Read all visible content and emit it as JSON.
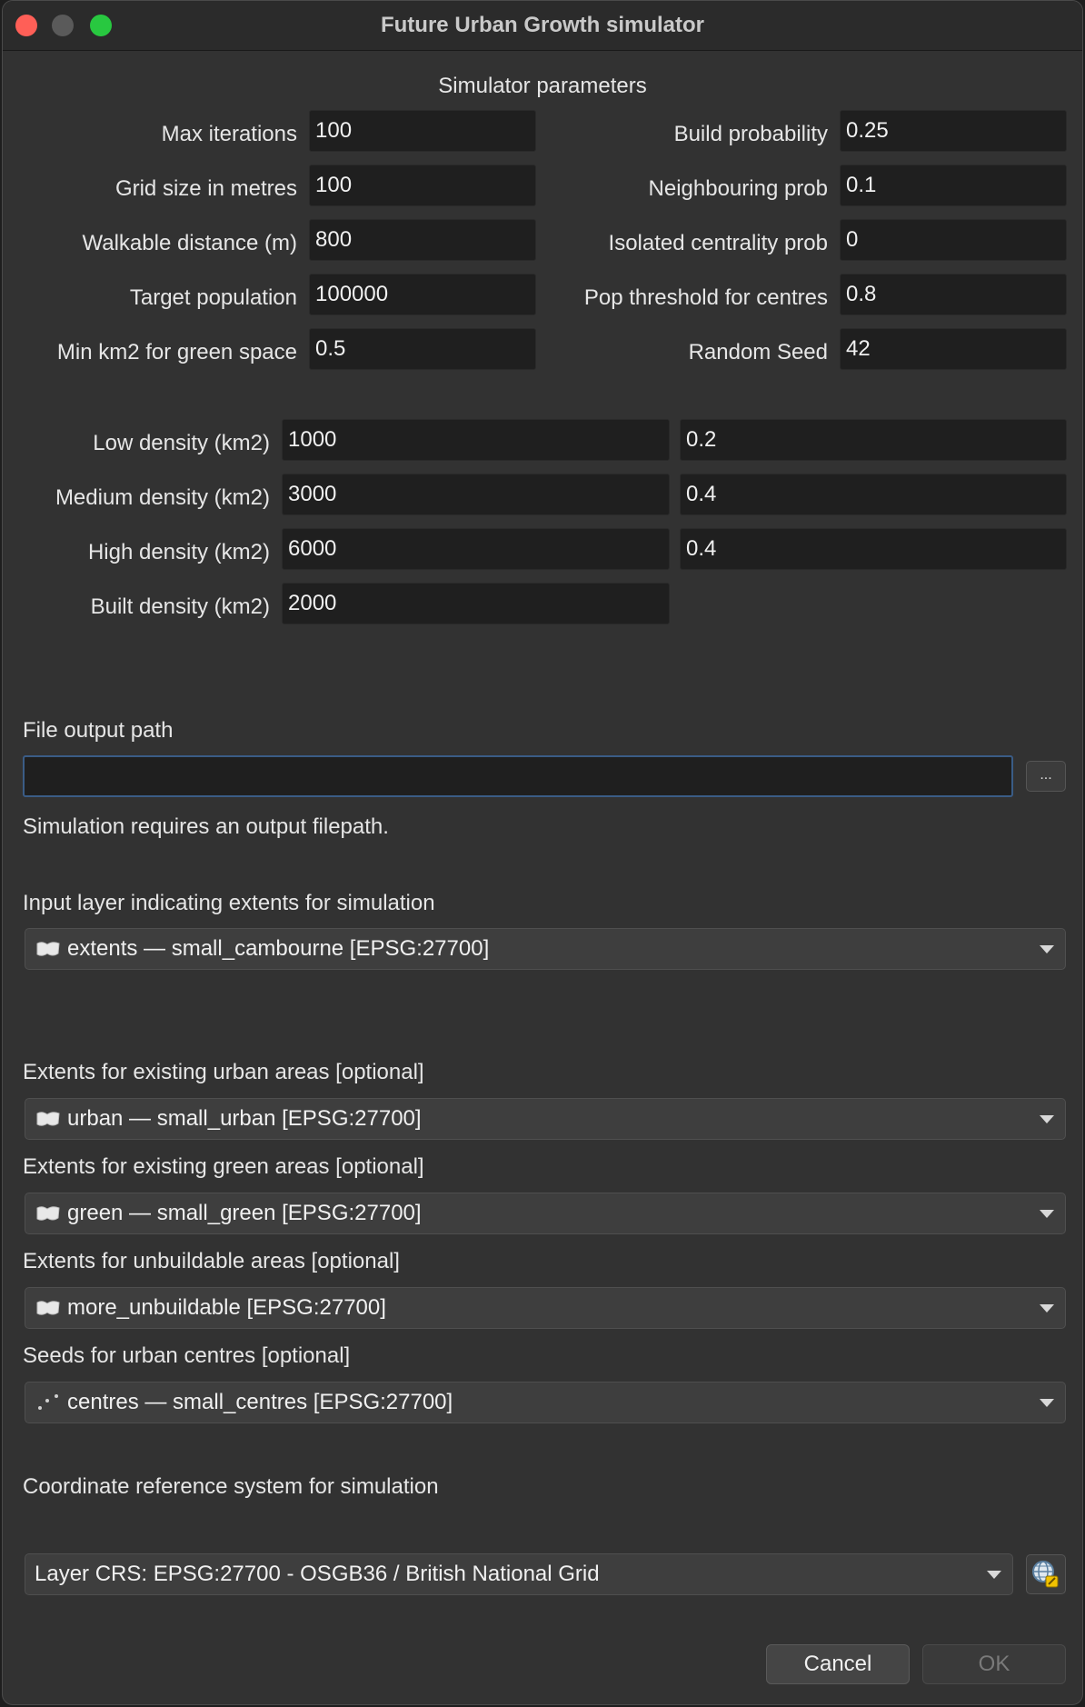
{
  "window": {
    "title": "Future Urban Growth simulator"
  },
  "section_title": "Simulator parameters",
  "left_params": [
    {
      "label": "Max iterations",
      "value": "100"
    },
    {
      "label": "Grid size in metres",
      "value": "100"
    },
    {
      "label": "Walkable distance (m)",
      "value": "800"
    },
    {
      "label": "Target population",
      "value": "100000"
    },
    {
      "label": "Min km2 for green space",
      "value": "0.5"
    }
  ],
  "right_params": [
    {
      "label": "Build probability",
      "value": "0.25"
    },
    {
      "label": "Neighbouring prob",
      "value": "0.1"
    },
    {
      "label": "Isolated centrality prob",
      "value": "0"
    },
    {
      "label": "Pop threshold for centres",
      "value": "0.8"
    },
    {
      "label": "Random Seed",
      "value": "42"
    }
  ],
  "density": [
    {
      "label": "Low density (km2)",
      "value": "1000",
      "ratio": "0.2"
    },
    {
      "label": "Medium density (km2)",
      "value": "3000",
      "ratio": "0.4"
    },
    {
      "label": "High density (km2)",
      "value": "6000",
      "ratio": "0.4"
    },
    {
      "label": "Built density (km2)",
      "value": "2000"
    }
  ],
  "output": {
    "label": "File output path",
    "value": "",
    "browse_label": "...",
    "hint": "Simulation requires an output filepath."
  },
  "extents": {
    "label": "Input layer indicating extents for simulation",
    "value": "extents — small_cambourne [EPSG:27700]",
    "icon": "polygon-layer-icon"
  },
  "layers": [
    {
      "label": "Extents for existing urban areas [optional]",
      "value": "urban — small_urban [EPSG:27700]",
      "icon": "polygon-layer-icon"
    },
    {
      "label": "Extents for existing green areas [optional]",
      "value": "green — small_green [EPSG:27700]",
      "icon": "polygon-layer-icon"
    },
    {
      "label": "Extents for unbuildable areas [optional]",
      "value": "more_unbuildable [EPSG:27700]",
      "icon": "polygon-layer-icon"
    },
    {
      "label": "Seeds for urban centres [optional]",
      "value": "centres — small_centres [EPSG:27700]",
      "icon": "point-layer-icon"
    }
  ],
  "crs": {
    "label": "Coordinate reference system for simulation",
    "value": "Layer CRS: EPSG:27700 - OSGB36 / British National Grid",
    "icon": "globe-crs-icon"
  },
  "buttons": {
    "cancel": "Cancel",
    "ok": "OK"
  }
}
